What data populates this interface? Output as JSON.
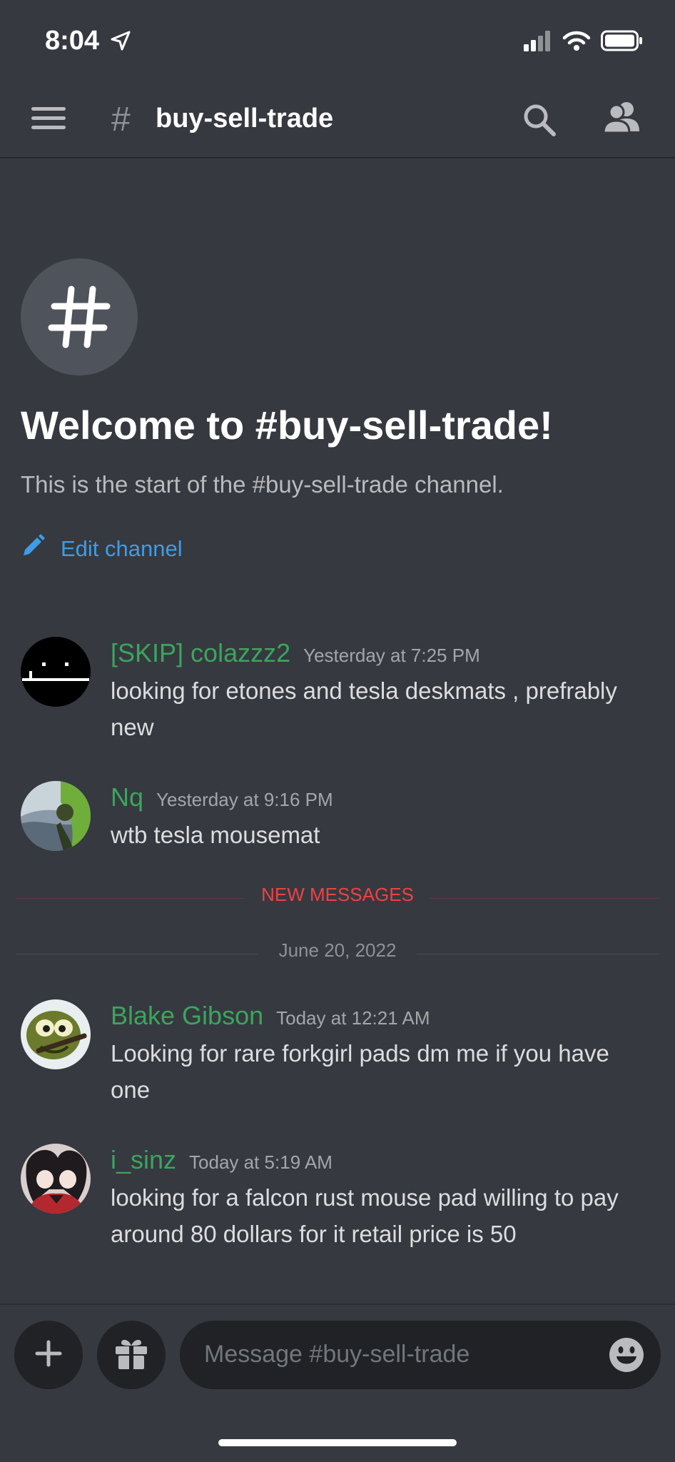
{
  "status_bar": {
    "time": "8:04"
  },
  "header": {
    "channel_hash": "#",
    "channel_name": "buy-sell-trade"
  },
  "welcome": {
    "badge_symbol": "#",
    "title": "Welcome to #buy-sell-trade!",
    "subtitle": "This is the start of the #buy-sell-trade channel.",
    "edit_label": "Edit channel"
  },
  "messages": [
    {
      "author": "[SKIP] colazzz2",
      "time": "Yesterday at 7:25 PM",
      "text": "looking for etones and tesla deskmats , prefrably new"
    },
    {
      "author": "Nq",
      "time": "Yesterday at 9:16 PM",
      "text": "wtb tesla mousemat"
    },
    {
      "author": "Blake Gibson",
      "time": "Today at 12:21 AM",
      "text": "Looking for rare forkgirl pads dm me if you have one"
    },
    {
      "author": "i_sinz",
      "time": "Today at 5:19 AM",
      "text": "looking for a falcon rust mouse pad willing to pay around 80 dollars for it retail price is 50"
    }
  ],
  "dividers": {
    "new_messages": "NEW MESSAGES",
    "date": "June 20, 2022"
  },
  "composer": {
    "placeholder": "Message #buy-sell-trade"
  },
  "colors": {
    "background": "#36393f",
    "username": "#3ba55d",
    "link": "#3e9ce8",
    "new_messages": "#ed4245"
  },
  "icons": [
    "location-arrow-icon",
    "signal-icon",
    "wifi-icon",
    "battery-icon",
    "hamburger-menu-icon",
    "search-icon",
    "members-icon",
    "pencil-icon",
    "plus-icon",
    "gift-icon",
    "emoji-icon"
  ]
}
